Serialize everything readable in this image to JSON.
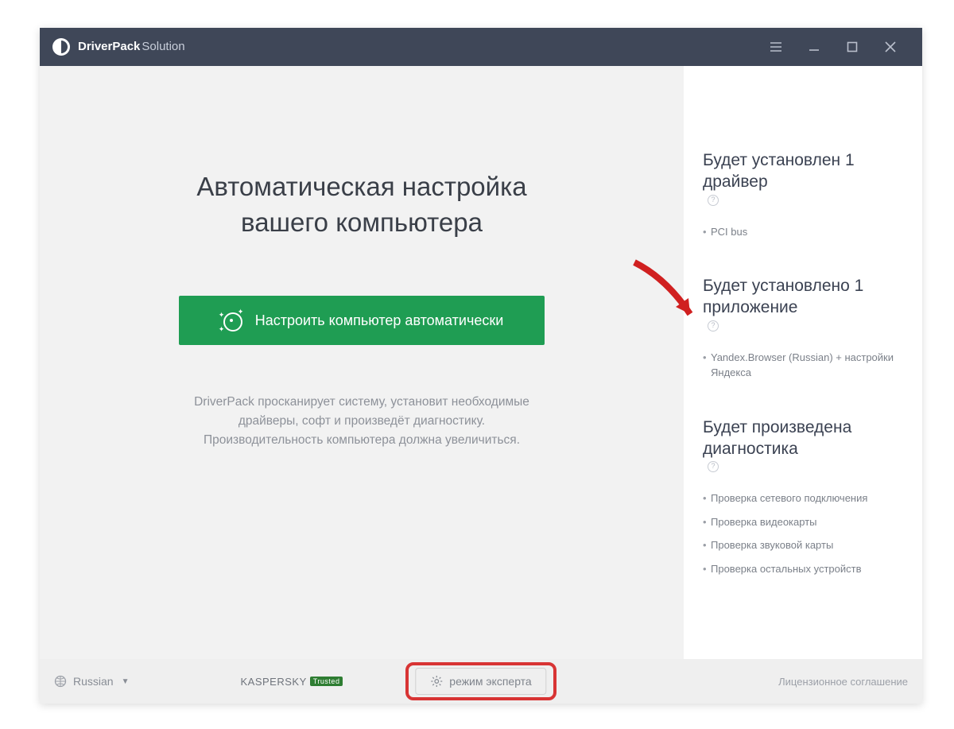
{
  "titlebar": {
    "brand_bold": "DriverPack",
    "brand_light": "Solution"
  },
  "main": {
    "title_line1": "Автоматическая настройка",
    "title_line2": "вашего компьютера",
    "primary_button_label": "Настроить компьютер автоматически",
    "description_line1": "DriverPack просканирует систему, установит необходимые",
    "description_line2": "драйверы, софт и произведёт диагностику.",
    "description_line3": "Производительность компьютера должна увеличиться."
  },
  "sidebar": {
    "sections": [
      {
        "heading": "Будет установлен 1 драйвер",
        "items": [
          "PCI bus"
        ]
      },
      {
        "heading": "Будет установлено 1 приложение",
        "items": [
          "Yandex.Browser (Russian) + настройки Яндекса"
        ]
      },
      {
        "heading": "Будет произведена диагностика",
        "items": [
          "Проверка сетевого подключения",
          "Проверка видеокарты",
          "Проверка звуковой карты",
          "Проверка остальных устройств"
        ]
      }
    ]
  },
  "footer": {
    "language_label": "Russian",
    "kaspersky_label": "KASPERSKY",
    "kaspersky_badge": "Trusted",
    "expert_mode_label": "режим эксперта",
    "license_link": "Лицензионное соглашение"
  }
}
